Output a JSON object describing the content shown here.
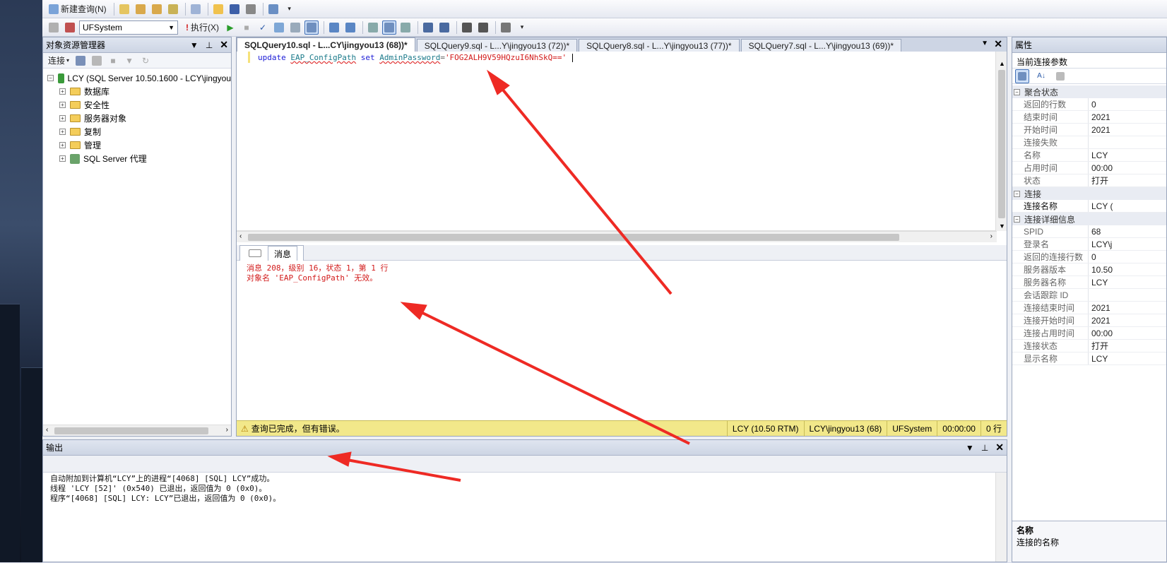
{
  "toolbar1": {
    "new_query": "新建查询(N)"
  },
  "toolbar2": {
    "database": "UFSystem",
    "execute": "执行(X)"
  },
  "object_explorer": {
    "title": "对象资源管理器",
    "connect": "连接",
    "server": "LCY (SQL Server 10.50.1600 - LCY\\jingyou",
    "nodes": [
      "数据库",
      "安全性",
      "服务器对象",
      "复制",
      "管理",
      "SQL Server 代理"
    ]
  },
  "editor": {
    "tabs": [
      "SQLQuery10.sql - L...CY\\jingyou13 (68))*",
      "SQLQuery9.sql - L...Y\\jingyou13 (72))*",
      "SQLQuery8.sql - L...Y\\jingyou13 (77))*",
      "SQLQuery7.sql - L...Y\\jingyou13 (69))*"
    ],
    "code": {
      "k1": "update",
      "obj": "EAP_ConfigPath",
      "k2": "set",
      "col": "AdminPassword",
      "eq": "=",
      "val": "'FOG2ALH9V59HQzuI6NhSkQ=='"
    }
  },
  "messages": {
    "tab": "消息",
    "line1": "消息 208，级别 16，状态 1，第 1 行",
    "line2": "对象名 'EAP_ConfigPath' 无效。"
  },
  "status": {
    "text": "查询已完成，但有错误。",
    "server": "LCY (10.50 RTM)",
    "user": "LCY\\jingyou13 (68)",
    "db": "UFSystem",
    "time": "00:00:00",
    "rows": "0 行"
  },
  "output": {
    "title": "输出",
    "lines": [
      "自动附加到计算机“LCY”上的进程“[4068] [SQL] LCY”成功。",
      "线程 'LCY [52]' (0x540) 已退出，返回值为 0 (0x0)。",
      "程序“[4068] [SQL] LCY: LCY”已退出，返回值为 0 (0x0)。"
    ]
  },
  "properties": {
    "title": "属性",
    "selector": "当前连接参数",
    "cat1": "聚合状态",
    "rows1": [
      [
        "返回的行数",
        "0"
      ],
      [
        "结束时间",
        "2021"
      ],
      [
        "开始时间",
        "2021"
      ],
      [
        "连接失败",
        ""
      ],
      [
        "名称",
        "LCY"
      ],
      [
        "占用时间",
        "00:00"
      ],
      [
        "状态",
        "打开"
      ]
    ],
    "cat2": "连接",
    "rows2": [
      [
        "连接名称",
        "LCY ("
      ]
    ],
    "cat3": "连接详细信息",
    "rows3": [
      [
        "SPID",
        "68"
      ],
      [
        "登录名",
        "LCY\\j"
      ],
      [
        "返回的连接行数",
        "0"
      ],
      [
        "服务器版本",
        "10.50"
      ],
      [
        "服务器名称",
        "LCY"
      ],
      [
        "会话跟踪 ID",
        ""
      ],
      [
        "连接结束时间",
        "2021"
      ],
      [
        "连接开始时间",
        "2021"
      ],
      [
        "连接占用时间",
        "00:00"
      ],
      [
        "连接状态",
        "打开"
      ],
      [
        "显示名称",
        "LCY"
      ]
    ],
    "footer_title": "名称",
    "footer_desc": "连接的名称"
  },
  "colors": {
    "error": "#d21a1a",
    "arrow": "#ee2a24",
    "status_bg": "#f2e88a"
  }
}
